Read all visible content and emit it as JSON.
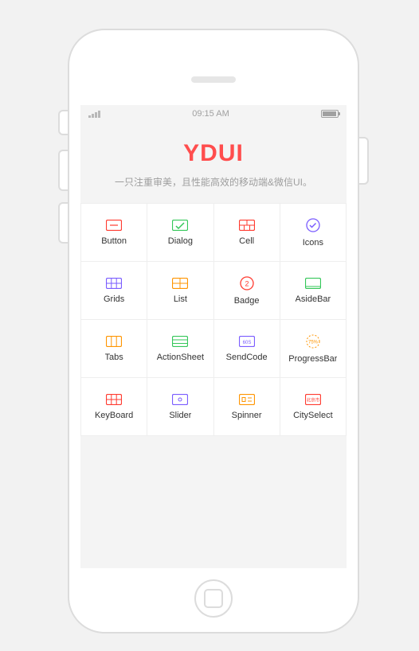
{
  "status": {
    "time": "09:15 AM",
    "battery_pct": 95
  },
  "hero": {
    "title": "YDUI",
    "title_color": "#ff4d4d",
    "subtitle": "一只注重审美，且性能高效的移动端&微信UI。"
  },
  "grid": {
    "items": [
      {
        "id": "button",
        "label": "Button",
        "icon": "button-icon",
        "color": "#ff3b30"
      },
      {
        "id": "dialog",
        "label": "Dialog",
        "icon": "dialog-icon",
        "color": "#34c759"
      },
      {
        "id": "cell",
        "label": "Cell",
        "icon": "cell-icon",
        "color": "#ff3b30"
      },
      {
        "id": "icons",
        "label": "Icons",
        "icon": "check-circle-icon",
        "color": "#7a5cff"
      },
      {
        "id": "grids",
        "label": "Grids",
        "icon": "grids-icon",
        "color": "#7a5cff"
      },
      {
        "id": "list",
        "label": "List",
        "icon": "list-icon",
        "color": "#ff9500"
      },
      {
        "id": "badge",
        "label": "Badge",
        "icon": "badge-icon",
        "color": "#ff3b30",
        "text": "2"
      },
      {
        "id": "asidebar",
        "label": "AsideBar",
        "icon": "asidebar-icon",
        "color": "#34c759"
      },
      {
        "id": "tabs",
        "label": "Tabs",
        "icon": "tabs-icon",
        "color": "#ff9500"
      },
      {
        "id": "actionsheet",
        "label": "ActionSheet",
        "icon": "actionsheet-icon",
        "color": "#34c759"
      },
      {
        "id": "sendcode",
        "label": "SendCode",
        "icon": "sendcode-icon",
        "color": "#7a5cff",
        "text": "60S"
      },
      {
        "id": "progressbar",
        "label": "ProgressBar",
        "icon": "progress-icon",
        "color": "#ff9500",
        "text": "75%"
      },
      {
        "id": "keyboard",
        "label": "KeyBoard",
        "icon": "keyboard-icon",
        "color": "#ff3b30"
      },
      {
        "id": "slider",
        "label": "Slider",
        "icon": "slider-icon",
        "color": "#7a5cff"
      },
      {
        "id": "spinner",
        "label": "Spinner",
        "icon": "spinner-icon",
        "color": "#ff9500"
      },
      {
        "id": "cityselect",
        "label": "CitySelect",
        "icon": "cityselect-icon",
        "color": "#ff3b30"
      }
    ]
  }
}
